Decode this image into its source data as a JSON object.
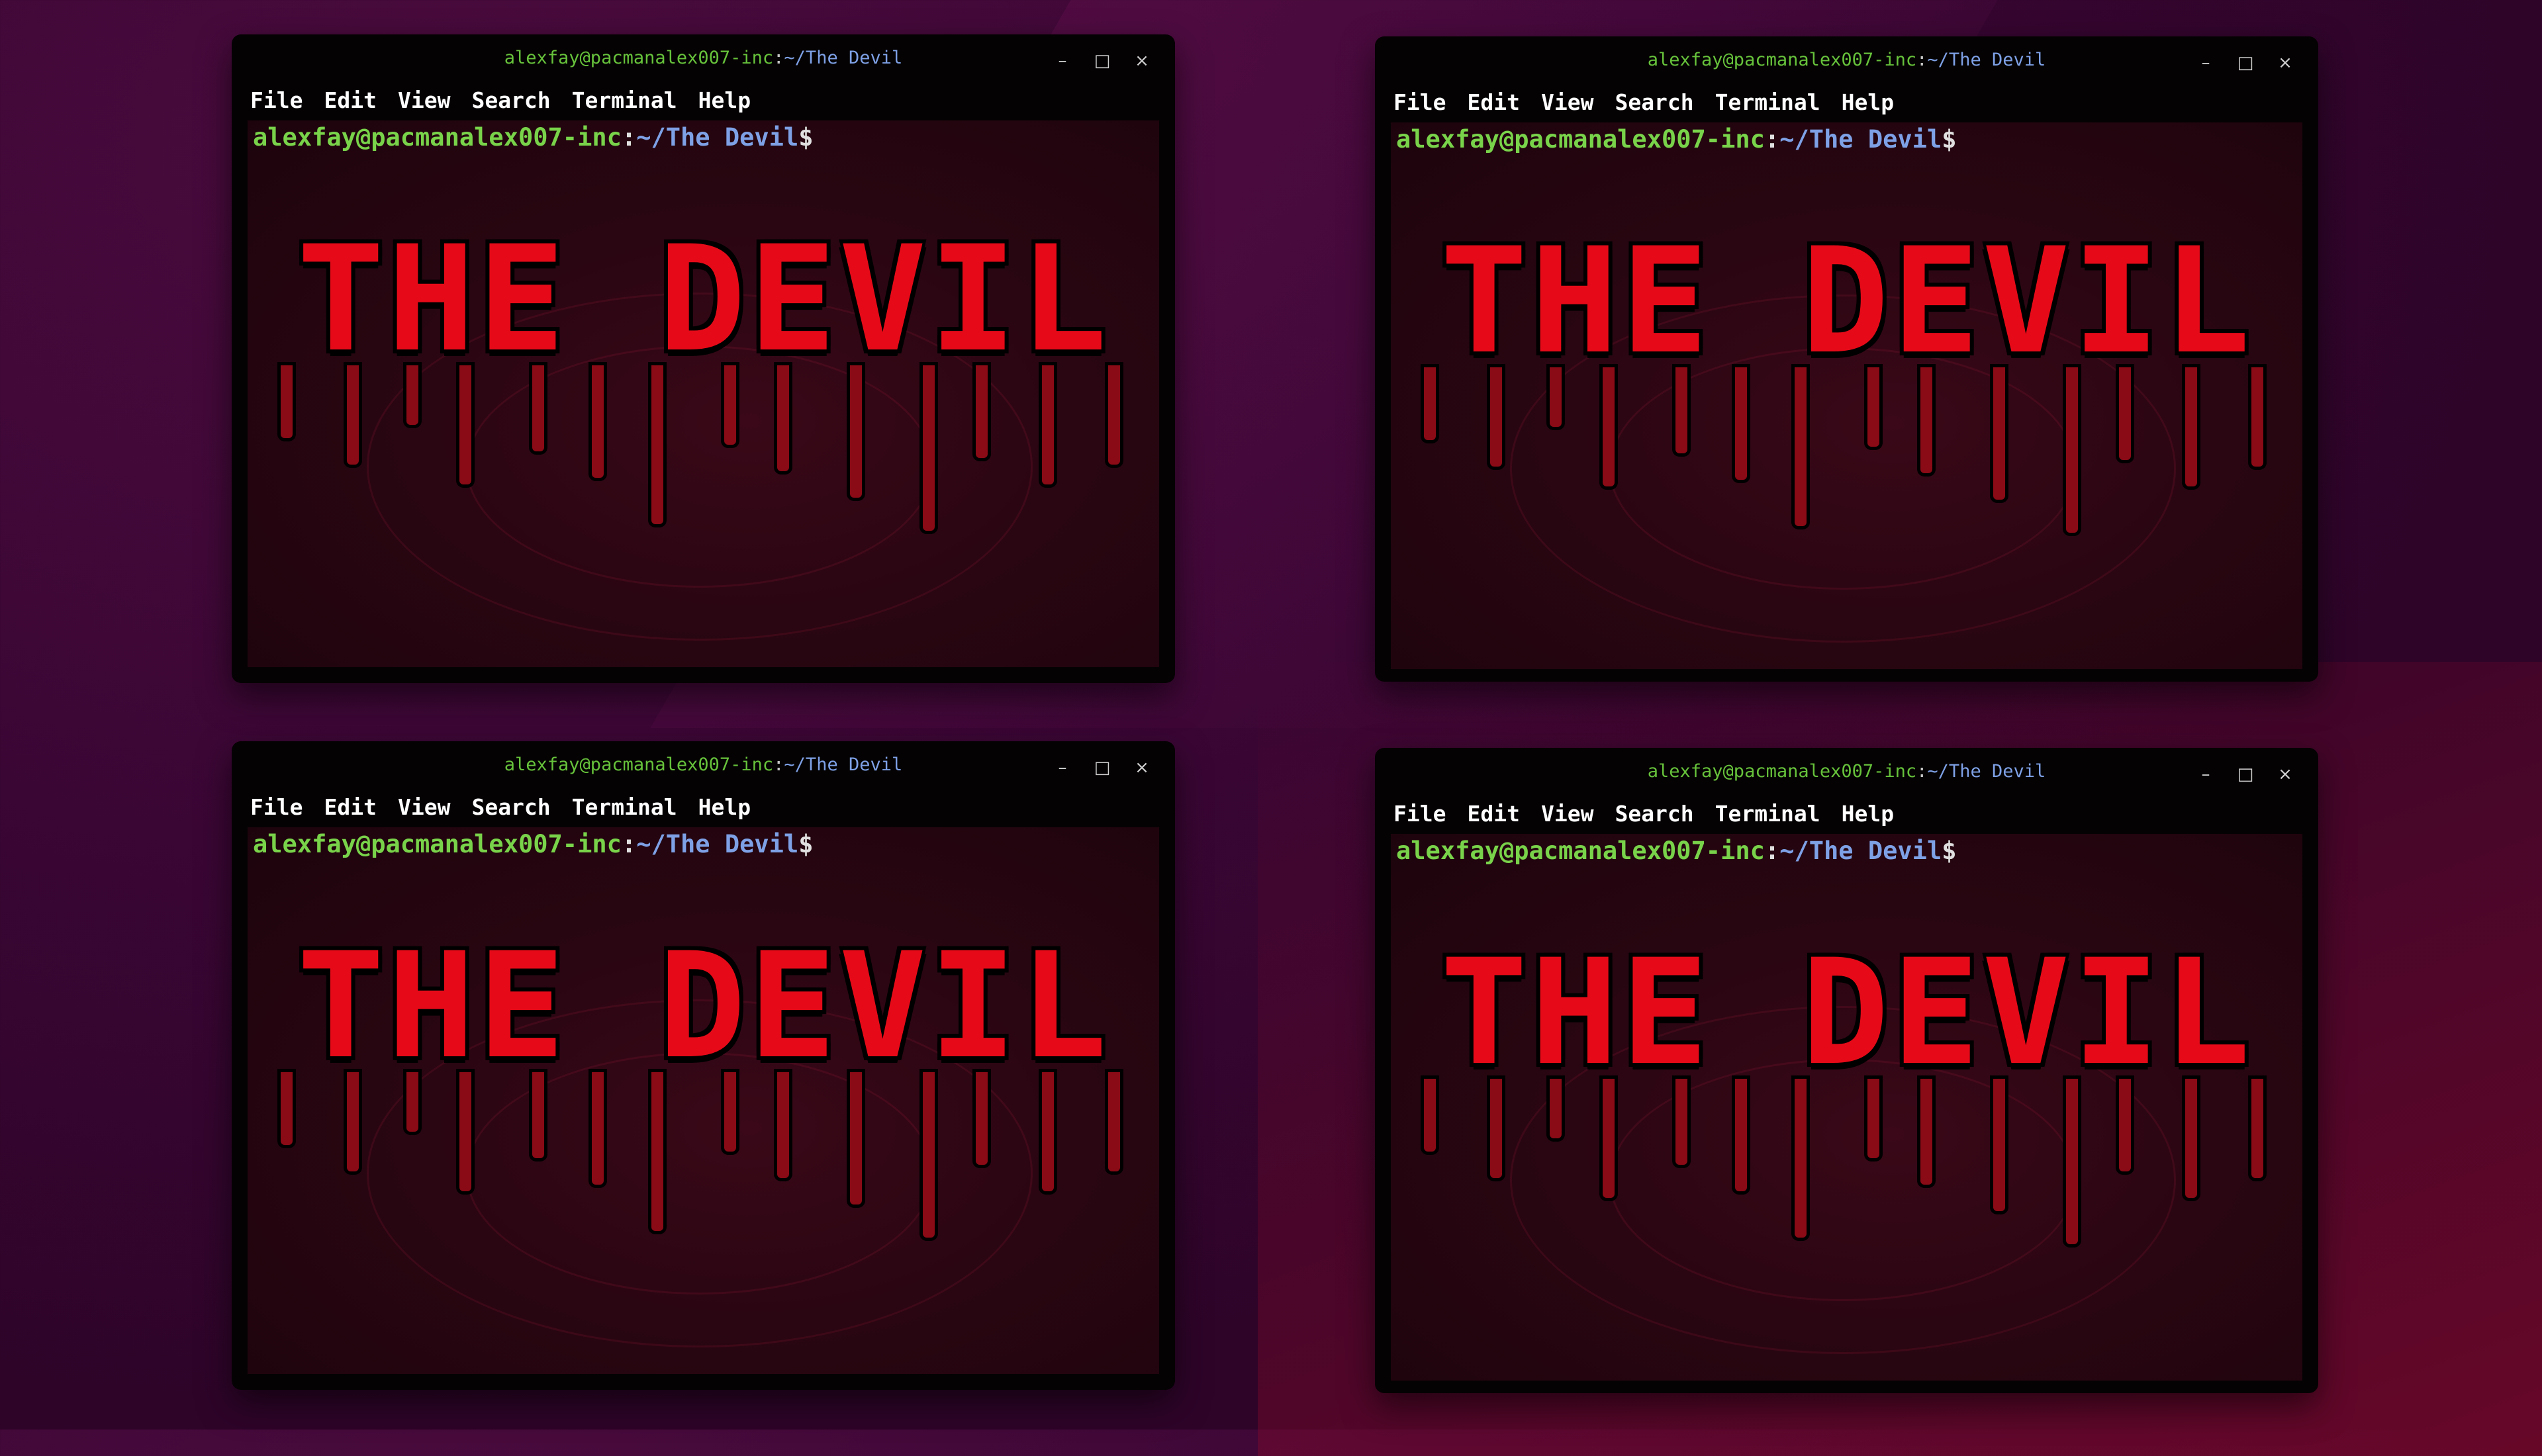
{
  "windows": [
    {
      "title_user": "alexfay@pacmanalex007-inc",
      "title_sep": ":",
      "title_path": "~/The Devil",
      "buttons": {
        "minimize": "–",
        "maximize": "□",
        "close": "×"
      },
      "menu": [
        "File",
        "Edit",
        "View",
        "Search",
        "Terminal",
        "Help"
      ],
      "prompt": {
        "user": "alexfay@pacmanalex007-inc",
        "colon": ":",
        "path": "~/The Devil",
        "symbol": "$"
      },
      "banner": "THE DEVIL"
    },
    {
      "title_user": "alexfay@pacmanalex007-inc",
      "title_sep": ":",
      "title_path": "~/The Devil",
      "buttons": {
        "minimize": "–",
        "maximize": "□",
        "close": "×"
      },
      "menu": [
        "File",
        "Edit",
        "View",
        "Search",
        "Terminal",
        "Help"
      ],
      "prompt": {
        "user": "alexfay@pacmanalex007-inc",
        "colon": ":",
        "path": "~/The Devil",
        "symbol": "$"
      },
      "banner": "THE DEVIL"
    },
    {
      "title_user": "alexfay@pacmanalex007-inc",
      "title_sep": ":",
      "title_path": "~/The Devil",
      "buttons": {
        "minimize": "–",
        "maximize": "□",
        "close": "×"
      },
      "menu": [
        "File",
        "Edit",
        "View",
        "Search",
        "Terminal",
        "Help"
      ],
      "prompt": {
        "user": "alexfay@pacmanalex007-inc",
        "colon": ":",
        "path": "~/The Devil",
        "symbol": "$"
      },
      "banner": "THE DEVIL"
    },
    {
      "title_user": "alexfay@pacmanalex007-inc",
      "title_sep": ":",
      "title_path": "~/The Devil",
      "buttons": {
        "minimize": "–",
        "maximize": "□",
        "close": "×"
      },
      "menu": [
        "File",
        "Edit",
        "View",
        "Search",
        "Terminal",
        "Help"
      ],
      "prompt": {
        "user": "alexfay@pacmanalex007-inc",
        "colon": ":",
        "path": "~/The Devil",
        "symbol": "$"
      },
      "banner": "THE DEVIL"
    }
  ],
  "colors": {
    "desktop_bg": "#33052d",
    "terminal_bg": "#2a0612",
    "prompt_user": "#79d34a",
    "prompt_path": "#7ea1e6",
    "banner": "#e60a18"
  },
  "icons": {
    "minimize": "minimize-icon",
    "maximize": "maximize-icon",
    "close": "close-icon"
  }
}
